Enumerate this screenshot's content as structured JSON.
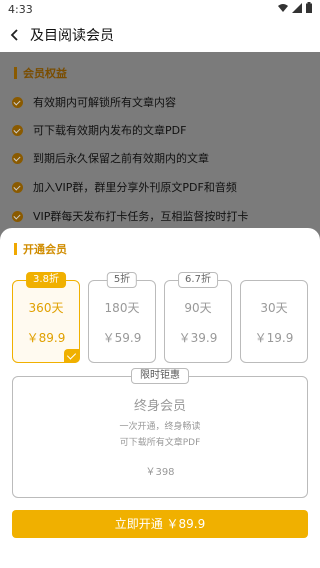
{
  "status_bar": {
    "time": "4:33"
  },
  "nav": {
    "title": "及目阅读会员"
  },
  "benefits": {
    "heading": "会员权益",
    "items": [
      "有效期内可解锁所有文章内容",
      "可下载有效期内发布的文章PDF",
      "到期后永久保留之前有效期内的文章",
      "加入VIP群，群里分享外刊原文PDF和音频",
      "VIP群每天发布打卡任务，互相监督按时打卡"
    ]
  },
  "sheet": {
    "heading": "开通会员",
    "plans": [
      {
        "badge": "3.8折",
        "days": "360天",
        "price": "￥89.9",
        "selected": true
      },
      {
        "badge": "5折",
        "days": "180天",
        "price": "￥59.9",
        "selected": false
      },
      {
        "badge": "6.7折",
        "days": "90天",
        "price": "￥39.9",
        "selected": false
      },
      {
        "badge": "",
        "days": "30天",
        "price": "￥19.9",
        "selected": false
      }
    ],
    "lifetime": {
      "badge": "限时钜惠",
      "name": "终身会员",
      "desc1": "一次开通，终身畅读",
      "desc2": "可下载所有文章PDF",
      "price": "￥398"
    },
    "cta_label": "立即开通 ￥89.9"
  },
  "colors": {
    "accent": "#f0b000"
  }
}
